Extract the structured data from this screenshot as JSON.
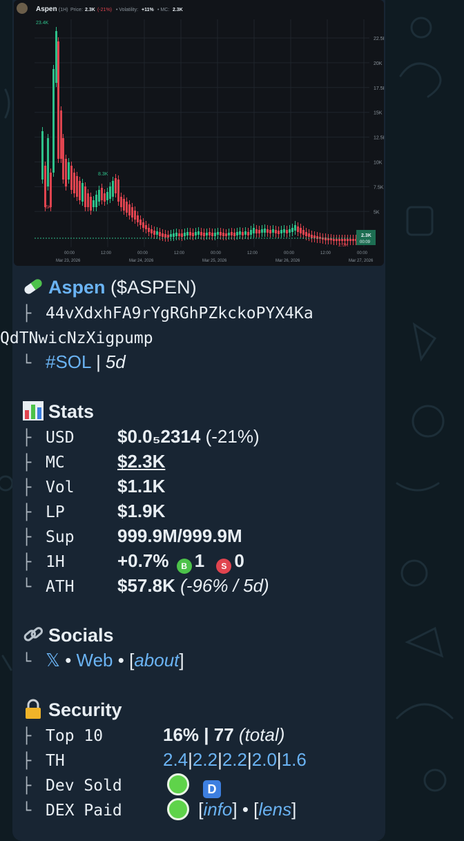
{
  "chart": {
    "header_name": "Aspen",
    "header_interval": "(1H)",
    "header_price_label": "Price:",
    "header_price_value": "2.3K",
    "header_price_change": "(-21%)",
    "header_vol_label": "• Volatility:",
    "header_vol_value": "+11%",
    "header_mc_label": "• MC:",
    "header_mc_value": "2.3K",
    "y_ticks": [
      "22.5K",
      "20K",
      "17.5K",
      "15K",
      "12.5K",
      "10K",
      "7.5K",
      "5K"
    ],
    "x_ticks": [
      "00:00",
      "12:00",
      "00:00",
      "12:00",
      "00:00",
      "12:00",
      "00:00",
      "12:00",
      "00:00"
    ],
    "x_dates": [
      "Mar 23, 2026",
      "Mar 24, 2026",
      "Mar 25, 2026",
      "Mar 26, 2026",
      "Mar 27, 2026"
    ],
    "high_marker": "23.4K",
    "low_marker": "6K",
    "mid_marker": "8.3K",
    "last_marker": "2.3K",
    "price_tag": "2.3K",
    "time_tag": "00:09",
    "colors": {
      "up": "#2ec08a",
      "down": "#e0444f",
      "grid": "#1f252c"
    }
  },
  "token": {
    "emoji": "pill",
    "name": "Aspen",
    "ticker": "($ASPEN)",
    "address_1": "44vXdxhFA9rYgRGhPZkckoPYX4Ka",
    "address_2": "QdTNwicNzXigpump",
    "chain": "#SOL",
    "age": "| 5d"
  },
  "stats": {
    "title": "Stats",
    "usd_key": "USD",
    "usd_value": "$0.0₅2314",
    "usd_change": "(-21%)",
    "mc_key": "MC",
    "mc_value": "$2.3K",
    "vol_key": "Vol",
    "vol_value": "$1.1K",
    "lp_key": "LP",
    "lp_value": "$1.9K",
    "sup_key": "Sup",
    "sup_value": "999.9M/999.9M",
    "h1_key": "1H",
    "h1_value": "+0.7%",
    "h1_buys": "1",
    "h1_sells": "0",
    "buy_badge": "B",
    "sell_badge": "S",
    "ath_key": "ATH",
    "ath_value": "$57.8K",
    "ath_detail": "(-96% / 5d)"
  },
  "socials": {
    "title": "Socials",
    "x_link": "𝕏",
    "sep1": "•",
    "web_link": "Web",
    "sep2": "•",
    "about_open": "[",
    "about_link": "about",
    "about_close": "]"
  },
  "security": {
    "title": "Security",
    "top10_key": "Top 10",
    "top10_pct": "16% | 77",
    "top10_total": "(total)",
    "th_key": "TH",
    "th_values": [
      "2.4",
      "2.2",
      "2.2",
      "2.0",
      "1.6"
    ],
    "dev_key": "Dev Sold",
    "dev_badge": "D",
    "dex_key": "DEX Paid",
    "info_link": "info",
    "lens_link": "lens"
  }
}
